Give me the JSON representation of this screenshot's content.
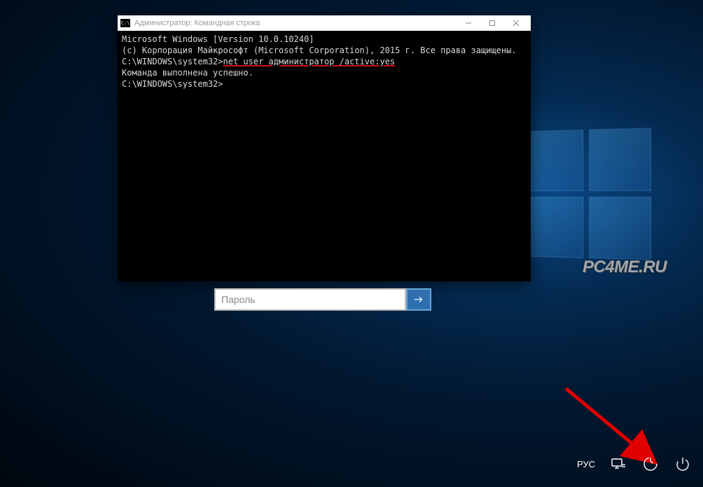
{
  "logo": {
    "panes": 4
  },
  "cmd": {
    "title": "Администратор: Командная строка",
    "lines": {
      "l1": "Microsoft Windows [Version 10.0.10240]",
      "l2": "(c) Корпорация Майкрософт (Microsoft Corporation), 2015 г. Все права защищены.",
      "blank1": "",
      "prompt1": "C:\\WINDOWS\\system32>",
      "command": "net user администратор /active:yes",
      "result": "Команда выполнена успешно.",
      "blank2": "",
      "blank3": "",
      "prompt2": "C:\\WINDOWS\\system32>"
    }
  },
  "login": {
    "password_placeholder": "Пароль"
  },
  "tray": {
    "language": "РУС"
  },
  "watermark": "PC4ME.RU"
}
